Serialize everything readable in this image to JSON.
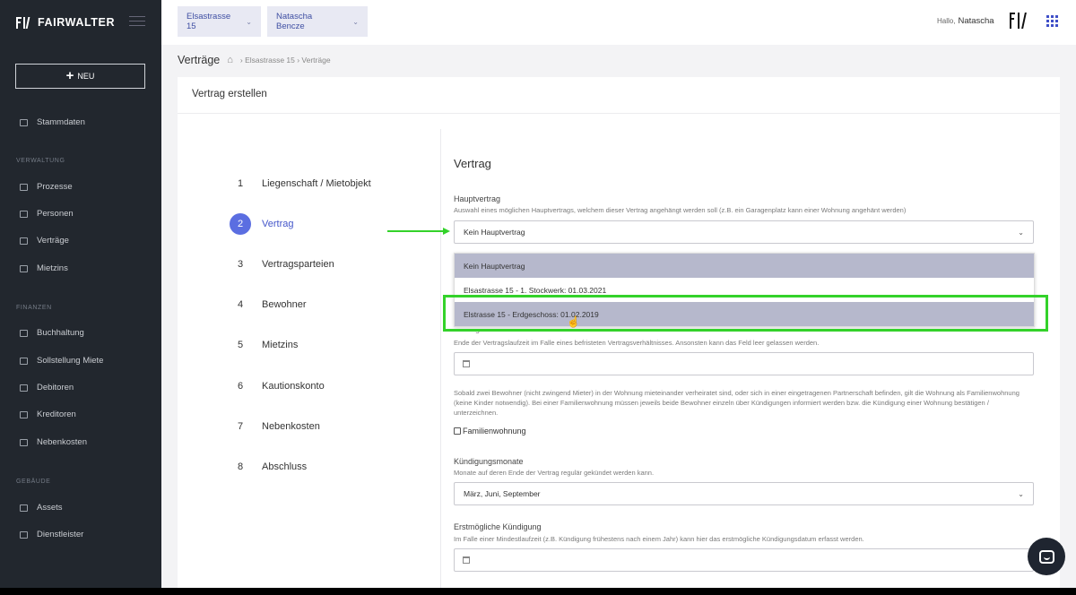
{
  "brand": {
    "name": "FAIRWALTER"
  },
  "sidebar": {
    "new_label": "NEU",
    "top_item": {
      "label": "Stammdaten",
      "icon": "database-icon"
    },
    "sections": [
      {
        "title": "VERWALTUNG",
        "items": [
          {
            "label": "Prozesse",
            "icon": "list-icon"
          },
          {
            "label": "Personen",
            "icon": "people-icon"
          },
          {
            "label": "Verträge",
            "icon": "document-icon"
          },
          {
            "label": "Mietzins",
            "icon": "money-icon"
          }
        ]
      },
      {
        "title": "FINANZEN",
        "items": [
          {
            "label": "Buchhaltung",
            "icon": "ledger-icon"
          },
          {
            "label": "Sollstellung Miete",
            "icon": "invoice-icon"
          },
          {
            "label": "Debitoren",
            "icon": "debit-icon"
          },
          {
            "label": "Kreditoren",
            "icon": "credit-icon"
          },
          {
            "label": "Nebenkosten",
            "icon": "costs-icon"
          }
        ]
      },
      {
        "title": "GEBÄUDE",
        "items": [
          {
            "label": "Assets",
            "icon": "assets-icon"
          },
          {
            "label": "Dienstleister",
            "icon": "service-provider-icon"
          }
        ]
      }
    ]
  },
  "topbar": {
    "property_selector": "Elsastrasse 15",
    "person_selector": "Natascha Bencze",
    "greeting": "Hallo,",
    "user_name": "Natascha"
  },
  "breadcrumb": {
    "title": "Verträge",
    "path": "› Elsastrasse 15 › Verträge"
  },
  "card": {
    "title": "Vertrag erstellen"
  },
  "steps": [
    {
      "num": "1",
      "label": "Liegenschaft / Mietobjekt"
    },
    {
      "num": "2",
      "label": "Vertrag",
      "active": true
    },
    {
      "num": "3",
      "label": "Vertragsparteien"
    },
    {
      "num": "4",
      "label": "Bewohner"
    },
    {
      "num": "5",
      "label": "Mietzins"
    },
    {
      "num": "6",
      "label": "Kautionskonto"
    },
    {
      "num": "7",
      "label": "Nebenkosten"
    },
    {
      "num": "8",
      "label": "Abschluss"
    }
  ],
  "form": {
    "heading": "Vertrag",
    "hauptvertrag": {
      "label": "Hauptvertrag",
      "hint": "Auswahl eines möglichen Hauptvertrags, welchem dieser Vertrag angehängt werden soll (z.B. ein Garagenplatz kann einer Wohnung angehänt werden)",
      "value": "Kein Hauptvertrag",
      "options": [
        "Kein Hauptvertrag",
        "Elsastrasse 15 - 1. Stockwerk: 01.03.2021",
        "Elstrasse 15 - Erdgeschoss: 01.02.2019"
      ]
    },
    "vertragsende": {
      "label_fragment": "Vertragsende",
      "hint": "Ende der Vertragslaufzeit im Falle eines befristeten Vertragsverhältnisses. Ansonsten kann das Feld leer gelassen werden."
    },
    "familien": {
      "hint": "Sobald zwei Bewohner (nicht zwingend Mieter) in der Wohnung mieteinander verheiratet sind, oder sich in einer eingetragenen Partnerschaft befinden, gilt die Wohnung als Familienwohnung (keine Kinder notwendig). Bei einer Familienwohnung müssen jeweils beide Bewohner einzeln über Kündigungen informiert werden bzw. die Kündigung einer Wohnung bestätigen / unterzeichnen.",
      "checkbox_label": "Familienwohnung",
      "checked": false
    },
    "kuendigungsmonate": {
      "label": "Kündigungsmonate",
      "hint": "Monate auf deren Ende der Vertrag regulär gekündet werden kann.",
      "value": "März, Juni, September"
    },
    "erstmoegliche": {
      "label": "Erstmögliche Kündigung",
      "hint": "Im Falle einer Mindestlaufzeit (z.B. Kündigung frühestens nach einem Jahr) kann hier das erstmögliche Kündigungsdatum erfasst werden."
    }
  },
  "colors": {
    "accent": "#5b6ee1",
    "sidebar": "#22272e",
    "highlight_box": "#33d22a"
  }
}
